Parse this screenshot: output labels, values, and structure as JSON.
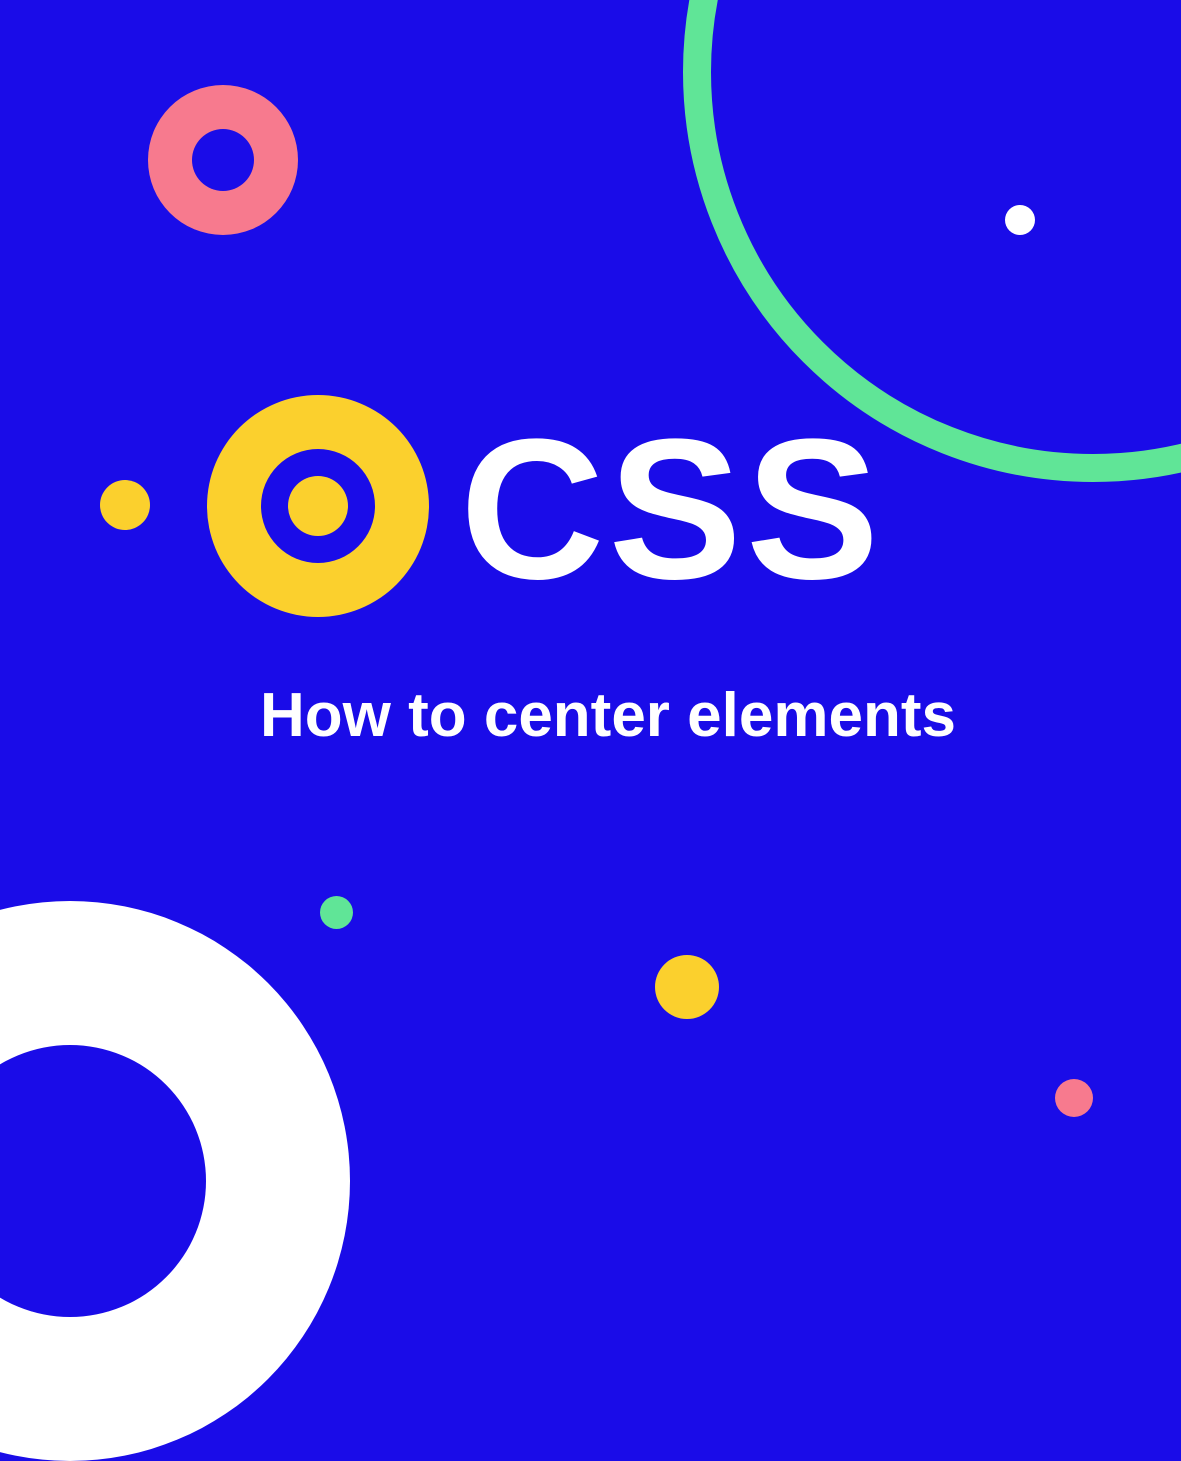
{
  "graphic": {
    "title": "CSS",
    "subtitle": "How to center elements"
  },
  "colors": {
    "background": "#1a0ce8",
    "pink": "#f77a8e",
    "green": "#60e597",
    "yellow": "#fbd02d",
    "white": "#ffffff"
  }
}
